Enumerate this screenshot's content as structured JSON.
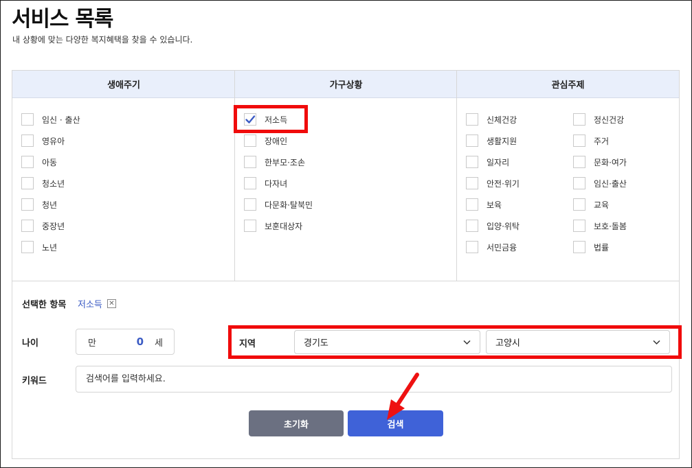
{
  "page": {
    "title": "서비스 목록",
    "subtitle": "내 상황에 맞는 다양한 복지혜택을 찾을 수 있습니다."
  },
  "columns": {
    "lifecycle": {
      "header": "생애주기",
      "options": [
        {
          "label": "임신 · 출산",
          "checked": false
        },
        {
          "label": "영유아",
          "checked": false
        },
        {
          "label": "아동",
          "checked": false
        },
        {
          "label": "청소년",
          "checked": false
        },
        {
          "label": "청년",
          "checked": false
        },
        {
          "label": "중장년",
          "checked": false
        },
        {
          "label": "노년",
          "checked": false
        }
      ]
    },
    "household": {
      "header": "가구상황",
      "options": [
        {
          "label": "저소득",
          "checked": true
        },
        {
          "label": "장애인",
          "checked": false
        },
        {
          "label": "한부모·조손",
          "checked": false
        },
        {
          "label": "다자녀",
          "checked": false
        },
        {
          "label": "다문화·탈북민",
          "checked": false
        },
        {
          "label": "보훈대상자",
          "checked": false
        }
      ]
    },
    "interest": {
      "header": "관심주제",
      "options_left": [
        {
          "label": "신체건강",
          "checked": false
        },
        {
          "label": "생활지원",
          "checked": false
        },
        {
          "label": "일자리",
          "checked": false
        },
        {
          "label": "안전·위기",
          "checked": false
        },
        {
          "label": "보육",
          "checked": false
        },
        {
          "label": "입양·위탁",
          "checked": false
        },
        {
          "label": "서민금융",
          "checked": false
        }
      ],
      "options_right": [
        {
          "label": "정신건강",
          "checked": false
        },
        {
          "label": "주거",
          "checked": false
        },
        {
          "label": "문화·여가",
          "checked": false
        },
        {
          "label": "임신·출산",
          "checked": false
        },
        {
          "label": "교육",
          "checked": false
        },
        {
          "label": "보호·돌봄",
          "checked": false
        },
        {
          "label": "법률",
          "checked": false
        }
      ]
    }
  },
  "selected": {
    "label": "선택한 항목",
    "chip": "저소득",
    "remove_icon": "close-icon"
  },
  "age": {
    "label": "나이",
    "prefix": "만",
    "value": "0",
    "suffix": "세"
  },
  "region": {
    "label": "지역",
    "province": "경기도",
    "city": "고양시",
    "icon": "chevron-down-icon"
  },
  "keyword": {
    "label": "키워드",
    "placeholder": "검색어를 입력하세요."
  },
  "buttons": {
    "reset": "초기화",
    "search": "검색"
  },
  "colors": {
    "accent": "#3b5bc4",
    "search_button": "#3f62d8",
    "reset_button": "#6b7081",
    "header_bg": "#e9effb",
    "highlight": "#f00b0b"
  }
}
